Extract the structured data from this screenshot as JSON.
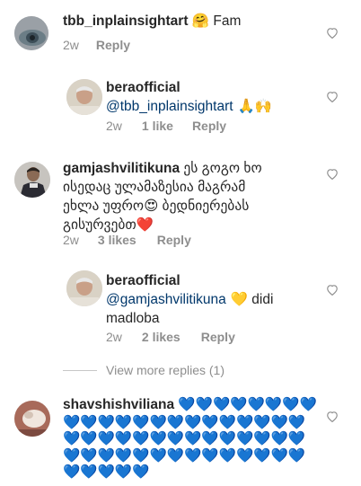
{
  "comments": [
    {
      "username": "tbb_inplainsightart",
      "text_emoji": "🤗",
      "text": " Fam",
      "time": "2w",
      "reply_label": "Reply"
    },
    {
      "username": "beraofficial",
      "mention": "@tbb_inplainsightart",
      "text_emoji": " 🙏🙌",
      "time": "2w",
      "likes": "1 like",
      "reply_label": "Reply"
    },
    {
      "username": "gamjashvilitikuna",
      "text_line1": " ეს გოგო ხო",
      "text_line2": "ისედაც ულამაზესია მაგრამ",
      "text_line3a": "ეხლა უფრო",
      "text_line3_emoji": "😍",
      "text_line3b": " ბედნიერებას",
      "text_line4": "გისურვებთ",
      "text_line4_emoji": "❤️",
      "time": "2w",
      "likes": "3 likes",
      "reply_label": "Reply"
    },
    {
      "username": "beraofficial",
      "mention": "@gamjashvilitikuna",
      "text_emoji": " 💛",
      "text_a": " didi",
      "text_line2": "madloba",
      "time": "2w",
      "likes": "2 likes",
      "reply_label": "Reply"
    },
    {
      "username": "shavshishviliana",
      "hearts_line1": "💙💙💙💙💙💙💙💙",
      "hearts_line2": "💙💙💙💙💙💙💙💙💙💙💙💙💙💙",
      "hearts_line3": "💙💙💙💙💙💙💙💙💙💙💙💙💙💙",
      "hearts_line4": "💙💙💙💙💙💙💙💙💙💙💙💙💙💙",
      "hearts_line5": "💙💙💙💙💙"
    }
  ],
  "view_replies": "View more replies (1)",
  "colors": {
    "meta": "#8e8e8e",
    "mention": "#00376b",
    "text": "#262626"
  }
}
